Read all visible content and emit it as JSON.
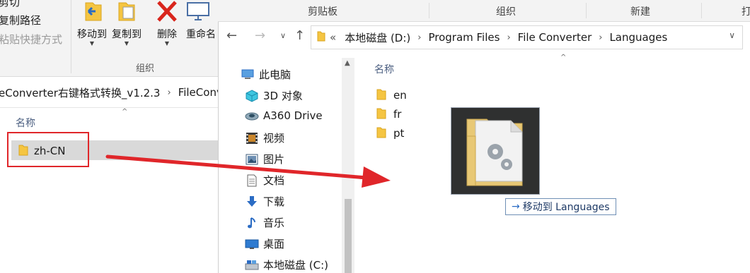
{
  "left_window": {
    "ribbon": {
      "cut_label": "剪切",
      "copy_path_label": "复制路径",
      "paste_shortcut_label": "粘贴快捷方式",
      "move_to_label": "移动到",
      "copy_to_label": "复制到",
      "delete_label": "删除",
      "rename_label": "重命名",
      "group_label": "组织"
    },
    "address": {
      "crumb_1": "eConverter右键格式转换_v1.2.3",
      "crumb_2": "FileConv"
    },
    "column_header": "名称",
    "items": [
      {
        "name": "zh-CN"
      }
    ]
  },
  "right_window": {
    "ribbon_groups": [
      "剪贴板",
      "组织",
      "新建",
      "打"
    ],
    "address": {
      "prefix": "«",
      "crumbs": [
        "本地磁盘 (D:)",
        "Program Files",
        "File Converter",
        "Languages"
      ]
    },
    "nav_tree": [
      {
        "label": "此电脑",
        "icon": "computer-icon"
      },
      {
        "label": "3D 对象",
        "icon": "cube-icon"
      },
      {
        "label": "A360 Drive",
        "icon": "cloud-drive-icon"
      },
      {
        "label": "视频",
        "icon": "video-icon"
      },
      {
        "label": "图片",
        "icon": "picture-icon"
      },
      {
        "label": "文档",
        "icon": "document-icon"
      },
      {
        "label": "下载",
        "icon": "download-icon"
      },
      {
        "label": "音乐",
        "icon": "music-icon"
      },
      {
        "label": "桌面",
        "icon": "desktop-icon"
      },
      {
        "label": "本地磁盘 (C:)",
        "icon": "drive-icon"
      }
    ],
    "column_header": "名称",
    "files": [
      {
        "name": "en"
      },
      {
        "name": "fr"
      },
      {
        "name": "pt"
      }
    ]
  },
  "drag": {
    "tooltip_label": "移动到 Languages"
  },
  "colors": {
    "annotation_red": "#e0262a",
    "folder_yellow": "#f5c542",
    "accent_blue": "#2b6cc4"
  }
}
